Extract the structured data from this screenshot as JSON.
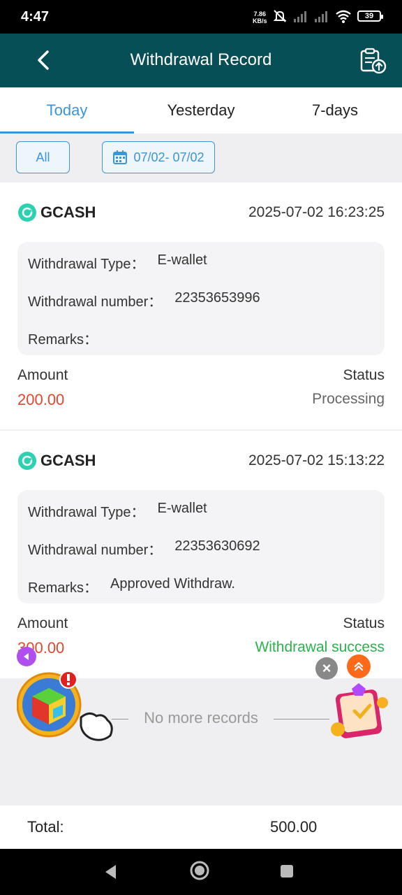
{
  "status_bar": {
    "time": "4:47",
    "speed_value": "7.86",
    "speed_unit": "KB/s",
    "battery": "39",
    "icons": [
      "mute-icon",
      "signal-icon",
      "signal-icon",
      "wifi-icon",
      "battery-icon"
    ]
  },
  "header": {
    "title": "Withdrawal Record",
    "back_icon": "chevron-left-icon",
    "export_icon": "clipboard-upload-icon"
  },
  "tabs": [
    {
      "label": "Today",
      "active": true
    },
    {
      "label": "Yesterday",
      "active": false
    },
    {
      "label": "7-days",
      "active": false
    }
  ],
  "filters": {
    "all_label": "All",
    "date_range": "07/02- 07/02",
    "date_icon": "calendar-icon"
  },
  "records": [
    {
      "method": "GCASH",
      "datetime": "2025-07-02 16:23:25",
      "type_label": "Withdrawal Type：",
      "type_value": "E-wallet",
      "number_label": "Withdrawal number：",
      "number_value": "22353653996",
      "remarks_label": "Remarks：",
      "remarks_value": "",
      "amount_label": "Amount",
      "amount_value": "200.00",
      "status_label": "Status",
      "status_value": "Processing"
    },
    {
      "method": "GCASH",
      "datetime": "2025-07-02 15:13:22",
      "type_label": "Withdrawal Type：",
      "type_value": "E-wallet",
      "number_label": "Withdrawal number：",
      "number_value": "22353630692",
      "remarks_label": "Remarks：",
      "remarks_value": "Approved Withdraw.",
      "amount_label": "Amount",
      "amount_value": "300.00",
      "status_label": "Status",
      "status_value": "Withdrawal success"
    }
  ],
  "no_more": "No more records",
  "total": {
    "label": "Total:",
    "value": "500.00"
  },
  "colors": {
    "header_bg": "#074f57",
    "accent": "#3a96d6",
    "amount": "#e0472f",
    "success": "#2bb24c"
  }
}
